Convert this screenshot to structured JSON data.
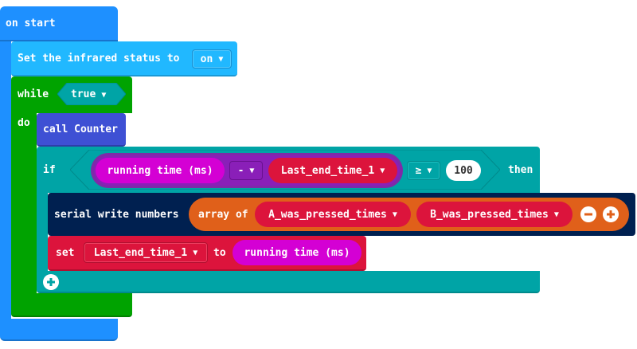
{
  "on_start": {
    "label": "on start"
  },
  "infrared": {
    "label": "Set the infrared status to",
    "value": "on"
  },
  "while_block": {
    "label": "while",
    "condition": "true",
    "do_label": "do"
  },
  "call_block": {
    "label": "call Counter"
  },
  "if_block": {
    "if_label": "if",
    "running_time": "running time (ms)",
    "operator": "-",
    "variable": "Last_end_time_1",
    "comparator": "≥",
    "threshold": "100",
    "then_label": "then"
  },
  "serial_block": {
    "label": "serial write numbers",
    "array_label": "array of",
    "item1": "A_was_pressed_times",
    "item2": "B_was_pressed_times"
  },
  "set_block": {
    "label": "set",
    "variable": "Last_end_time_1",
    "to_label": "to",
    "value": "running time (ms)"
  },
  "colors": {
    "events": "#1e90ff",
    "infrared": "#21b8ff",
    "loops": "#00a300",
    "functions": "#3e50d4",
    "logic": "#00a4a6",
    "advanced": "#002050",
    "arrays": "#e0601a",
    "variables": "#dc143c",
    "input": "#d400d4"
  },
  "icons": [
    "dropdown-caret-icon",
    "remove-item-icon",
    "add-item-icon",
    "add-else-icon"
  ]
}
